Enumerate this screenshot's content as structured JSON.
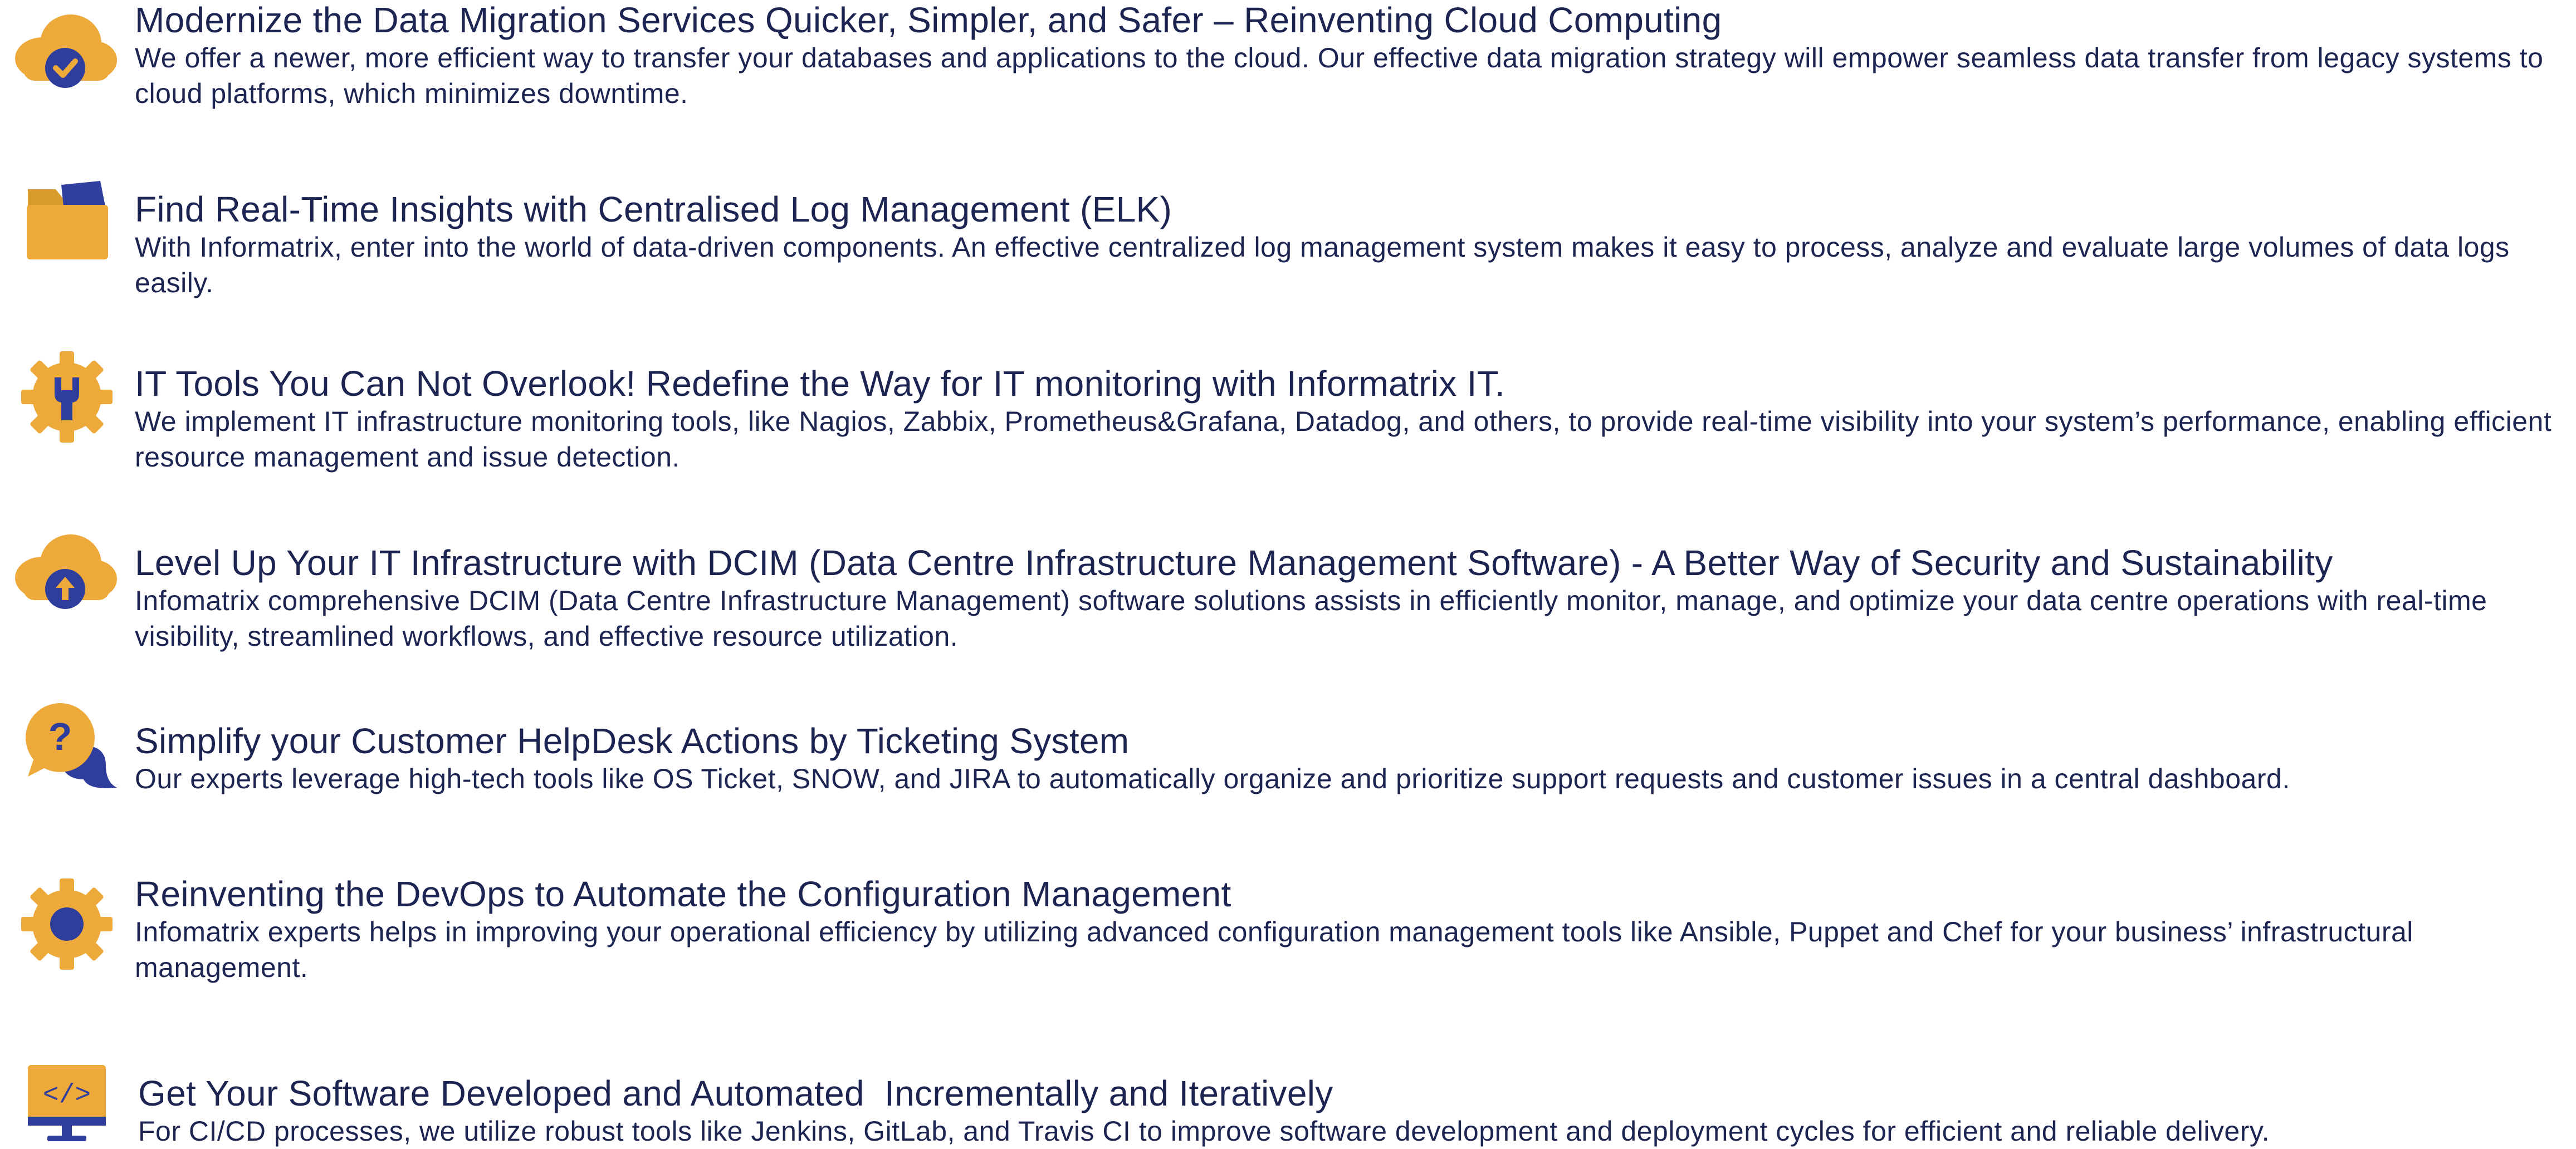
{
  "colors": {
    "accent": "#edaa3b",
    "brand": "#2f3d9c",
    "text": "#1c2452"
  },
  "services": [
    {
      "icon": "cloud-check-icon",
      "title": "Modernize the Data Migration Services Quicker, Simpler, and Safer – Reinventing Cloud Computing",
      "description": "We offer a newer, more efficient way to transfer your databases and applications to the cloud. Our effective data migration strategy will empower seamless data transfer from legacy systems to cloud platforms, which minimizes downtime."
    },
    {
      "icon": "folder-icon",
      "title": "Find Real-Time Insights with Centralised Log Management (ELK)",
      "description": "With Informatrix, enter into the world of data-driven components. An effective centralized log management system makes it easy to process, analyze and evaluate large volumes of data logs easily."
    },
    {
      "icon": "gear-wrench-icon",
      "title": "IT Tools You Can Not Overlook! Redefine the Way for IT monitoring with Informatrix IT.",
      "description": "We implement IT infrastructure monitoring tools, like Nagios, Zabbix, Prometheus&Grafana, Datadog, and others, to provide real-time visibility into your system’s performance, enabling efficient resource management and issue detection."
    },
    {
      "icon": "cloud-upload-icon",
      "title": "Level Up Your IT Infrastructure with DCIM (Data Centre Infrastructure Management Software) - A Better Way of Security and Sustainability",
      "description": "Infomatrix comprehensive DCIM (Data Centre Infrastructure Management) software solutions assists in efficiently monitor, manage, and optimize your data centre operations with real-time visibility, streamlined workflows, and effective resource utilization."
    },
    {
      "icon": "help-chat-icon",
      "title": "Simplify your Customer HelpDesk Actions by Ticketing System",
      "description": "Our experts leverage high-tech tools like OS Ticket, SNOW, and JIRA to automatically organize and prioritize support requests and customer issues in a central dashboard."
    },
    {
      "icon": "gear-icon",
      "title": "Reinventing the DevOps to Automate the Configuration Management",
      "description": "Infomatrix experts helps in improving your operational efficiency by utilizing advanced configuration management tools like Ansible, Puppet and Chef for your business’ infrastructural management."
    },
    {
      "icon": "code-monitor-icon",
      "title": "Get Your Software Developed and Automated  Incrementally and Iteratively",
      "description": "For CI/CD processes, we utilize robust tools like Jenkins, GitLab, and Travis CI to improve software development and deployment cycles for efficient and reliable delivery."
    }
  ]
}
